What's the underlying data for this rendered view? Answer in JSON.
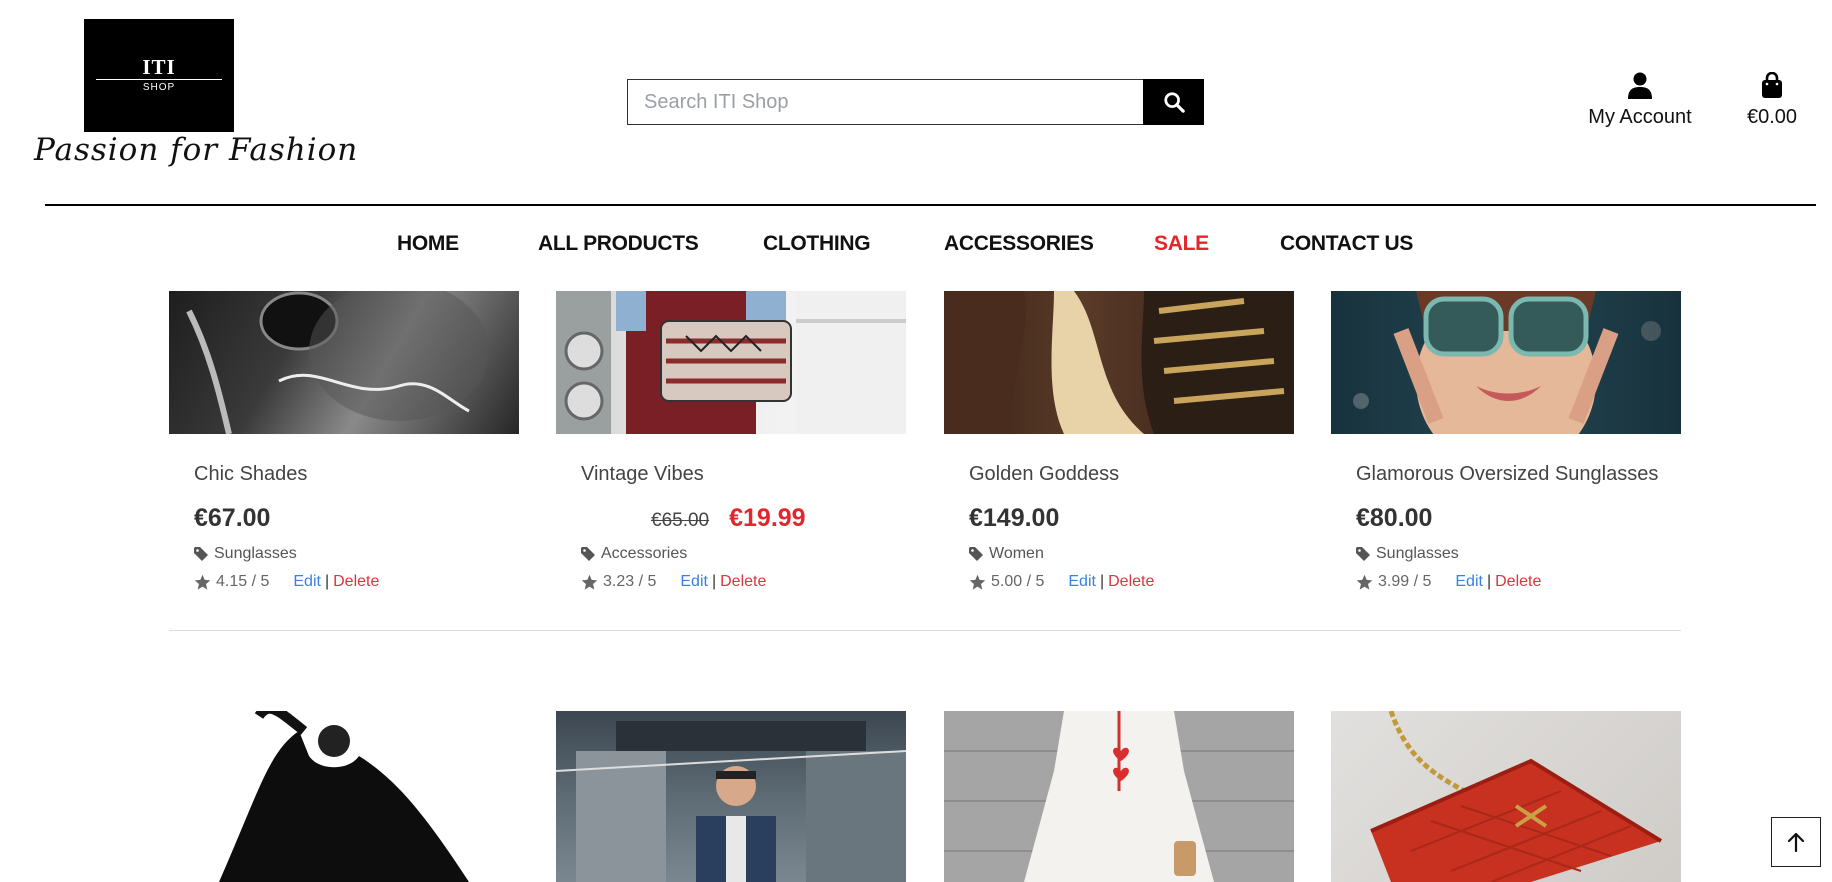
{
  "brand": {
    "logo_text": "ITI",
    "logo_subtext": "SHOP",
    "tagline": "Passion for Fashion"
  },
  "search": {
    "placeholder": "Search ITI Shop",
    "button_icon": "search-icon"
  },
  "header": {
    "account_label": "My Account",
    "account_icon": "user-icon",
    "cart_total": "€0.00",
    "cart_icon": "shopping-bag-icon"
  },
  "nav": {
    "items": [
      {
        "label": "HOME"
      },
      {
        "label": "ALL PRODUCTS"
      },
      {
        "label": "CLOTHING"
      },
      {
        "label": "ACCESSORIES"
      },
      {
        "label": "SALE",
        "color": "#e3262b"
      },
      {
        "label": "CONTACT US"
      }
    ]
  },
  "products": [
    {
      "name": "Chic Shades",
      "price": "€67.00",
      "category": "Sunglasses",
      "rating": "4.15 / 5",
      "edit": "Edit",
      "sep": "|",
      "delete": "Delete"
    },
    {
      "name": "Vintage Vibes",
      "old_price": "€65.00",
      "sale_price": "€19.99",
      "category": "Accessories",
      "rating": "3.23 / 5",
      "edit": "Edit",
      "sep": "|",
      "delete": "Delete"
    },
    {
      "name": "Golden Goddess",
      "price": "€149.00",
      "category": "Women",
      "rating": "5.00 / 5",
      "edit": "Edit",
      "sep": "|",
      "delete": "Delete"
    },
    {
      "name": "Glamorous Oversized Sunglasses",
      "price": "€80.00",
      "category": "Sunglasses",
      "rating": "3.99 / 5",
      "edit": "Edit",
      "sep": "|",
      "delete": "Delete"
    }
  ],
  "colors": {
    "accent": "#000000",
    "sale": "#e3262b",
    "edit_link": "#3b7fe0",
    "delete_link": "#d9363e"
  },
  "back_to_top_icon": "arrow-up-icon"
}
